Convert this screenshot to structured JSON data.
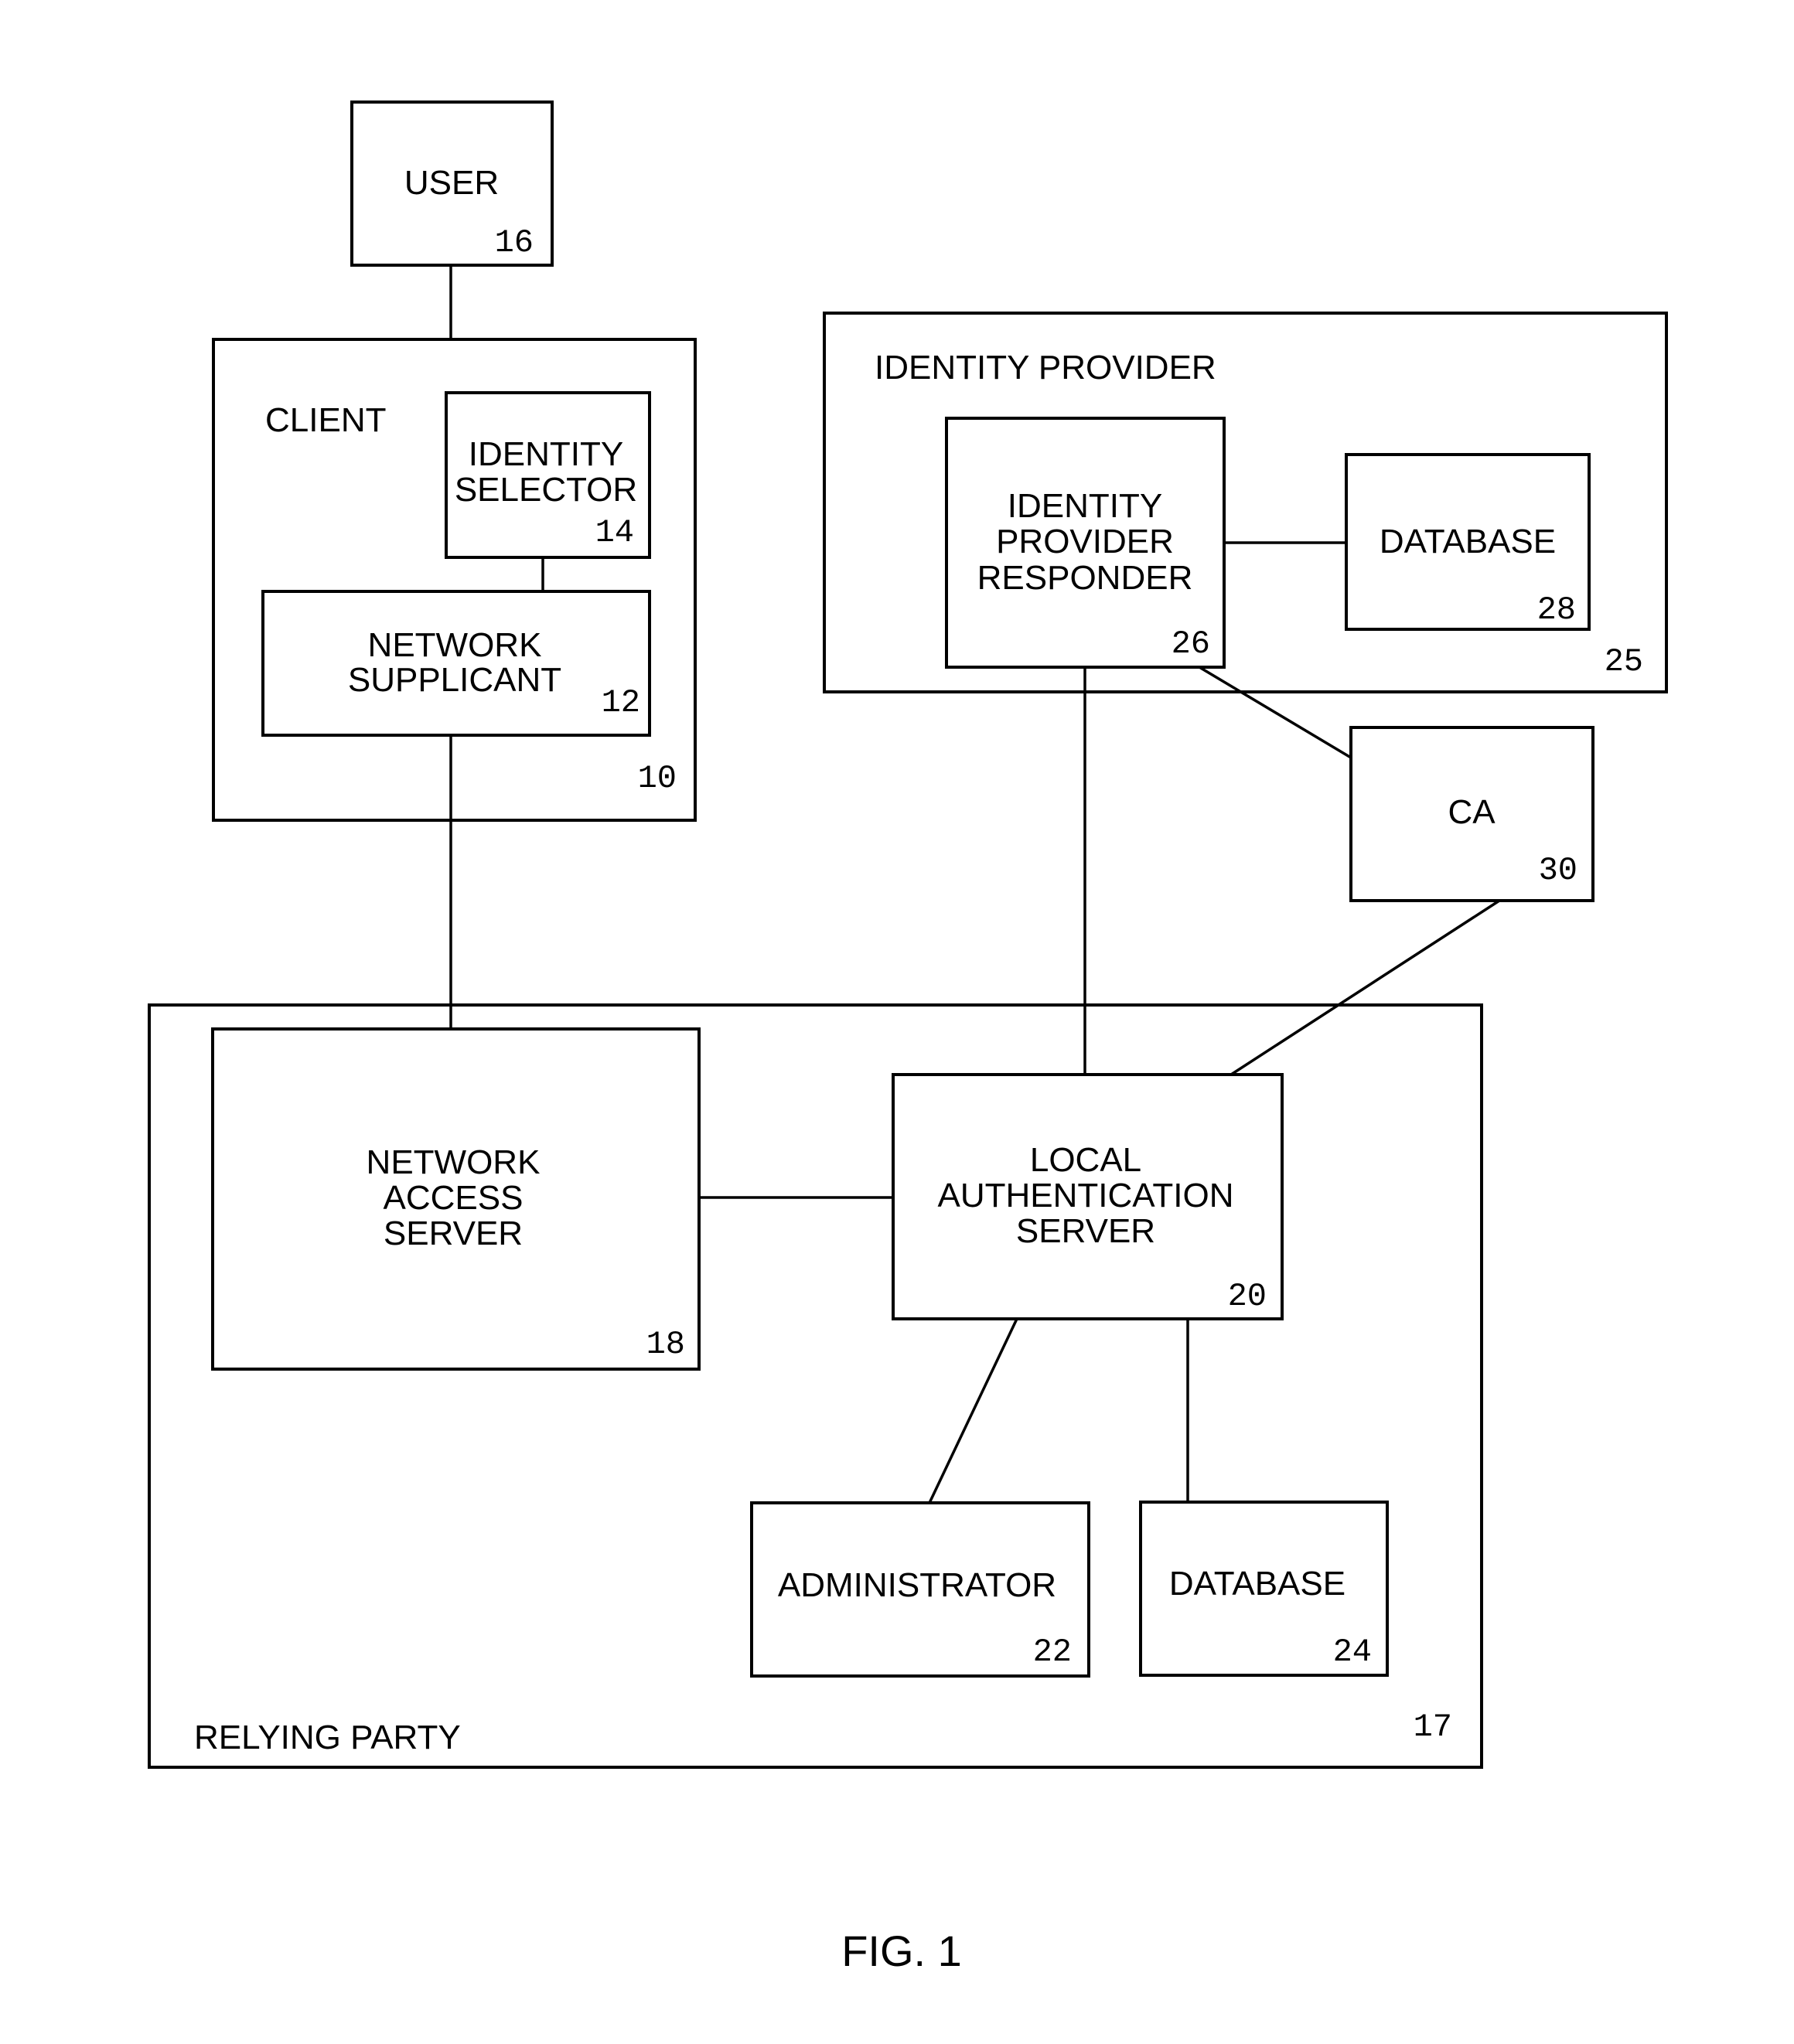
{
  "figure": {
    "caption": "FIG. 1"
  },
  "containers": {
    "client": {
      "label": "CLIENT",
      "ref": "10"
    },
    "identity_provider": {
      "label": "IDENTITY PROVIDER",
      "ref": "25"
    },
    "relying_party": {
      "label": "RELYING PARTY",
      "ref": "17"
    }
  },
  "nodes": {
    "user": {
      "lines": [
        "USER"
      ],
      "ref": "16"
    },
    "identity_selector": {
      "lines": [
        "IDENTITY",
        "SELECTOR"
      ],
      "ref": "14"
    },
    "network_supplicant": {
      "lines": [
        "NETWORK",
        "SUPPLICANT"
      ],
      "ref": "12"
    },
    "idp_responder": {
      "lines": [
        "IDENTITY",
        "PROVIDER",
        "RESPONDER"
      ],
      "ref": "26"
    },
    "idp_database": {
      "lines": [
        "DATABASE"
      ],
      "ref": "28"
    },
    "ca": {
      "lines": [
        "CA"
      ],
      "ref": "30"
    },
    "network_access_server": {
      "lines": [
        "NETWORK",
        "ACCESS",
        "SERVER"
      ],
      "ref": "18"
    },
    "local_auth_server": {
      "lines": [
        "LOCAL",
        "AUTHENTICATION",
        "SERVER"
      ],
      "ref": "20"
    },
    "administrator": {
      "lines": [
        "ADMINISTRATOR"
      ],
      "ref": "22"
    },
    "rp_database": {
      "lines": [
        "DATABASE"
      ],
      "ref": "24"
    }
  },
  "connections": [
    {
      "from": "user",
      "to": "client"
    },
    {
      "from": "identity_selector",
      "to": "network_supplicant"
    },
    {
      "from": "network_supplicant",
      "to": "network_access_server"
    },
    {
      "from": "idp_responder",
      "to": "idp_database"
    },
    {
      "from": "idp_responder",
      "to": "local_auth_server"
    },
    {
      "from": "idp_responder",
      "to": "ca"
    },
    {
      "from": "ca",
      "to": "local_auth_server"
    },
    {
      "from": "network_access_server",
      "to": "local_auth_server"
    },
    {
      "from": "local_auth_server",
      "to": "administrator"
    },
    {
      "from": "local_auth_server",
      "to": "rp_database"
    }
  ]
}
